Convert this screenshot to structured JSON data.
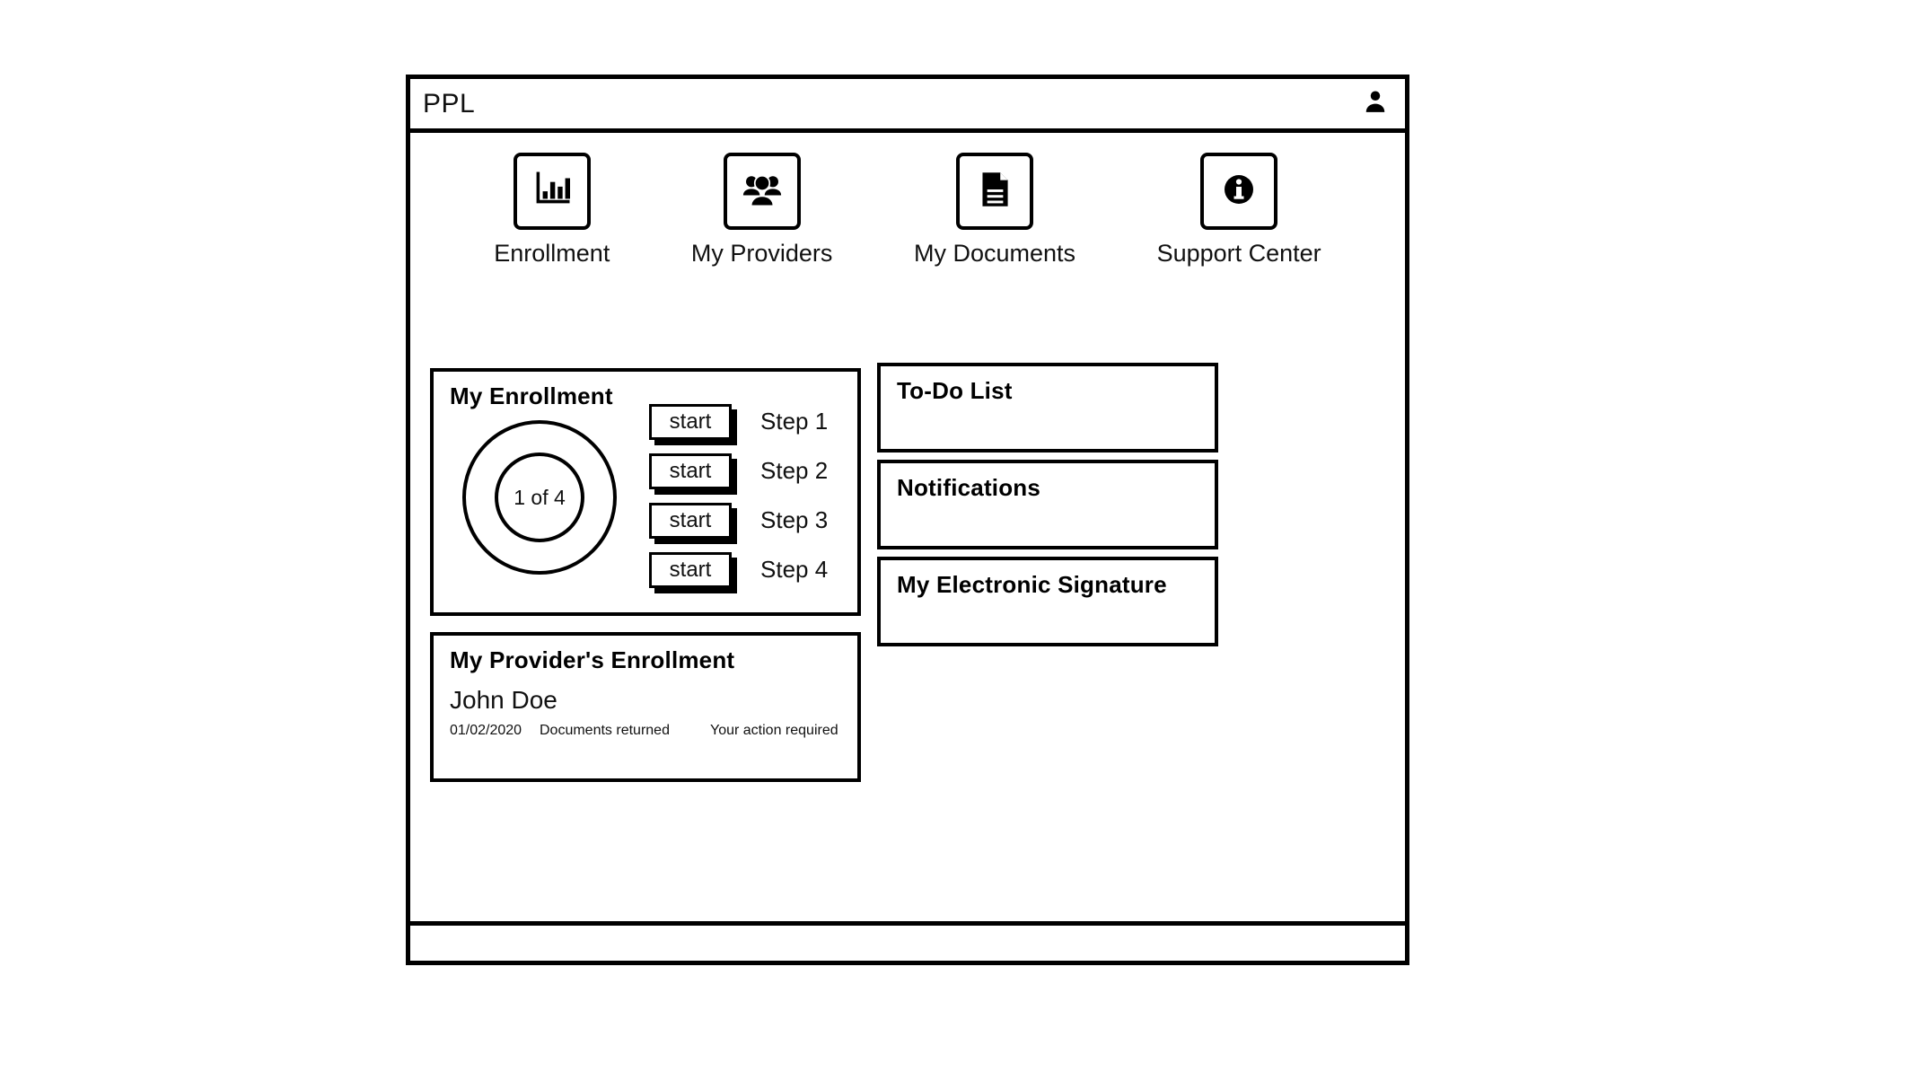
{
  "app": {
    "title": "PPL",
    "avatar_icon": "user-avatar-icon"
  },
  "nav": {
    "items": [
      {
        "label": "Enrollment",
        "icon": "bar-chart-icon"
      },
      {
        "label": "My Providers",
        "icon": "people-group-icon"
      },
      {
        "label": "My Documents",
        "icon": "document-icon"
      },
      {
        "label": "Support Center",
        "icon": "info-circle-icon"
      }
    ]
  },
  "enrollment": {
    "title": "My Enrollment",
    "progress_label": "1 of 4",
    "progress_current": 1,
    "progress_total": 4,
    "steps": [
      {
        "button_label": "start",
        "label": "Step 1"
      },
      {
        "button_label": "start",
        "label": "Step 2"
      },
      {
        "button_label": "start",
        "label": "Step 3"
      },
      {
        "button_label": "start",
        "label": "Step 4"
      }
    ]
  },
  "provider_enrollment": {
    "title": "My Provider's Enrollment",
    "name": "John Doe",
    "date": "01/02/2020",
    "status": "Documents returned",
    "action": "Your action required"
  },
  "side_panels": {
    "todo": {
      "title": "To-Do List"
    },
    "notifications": {
      "title": "Notifications"
    },
    "signature": {
      "title": "My Electronic Signature"
    }
  },
  "colors": {
    "stroke": "#000000",
    "background": "#ffffff",
    "text": "#111111"
  }
}
